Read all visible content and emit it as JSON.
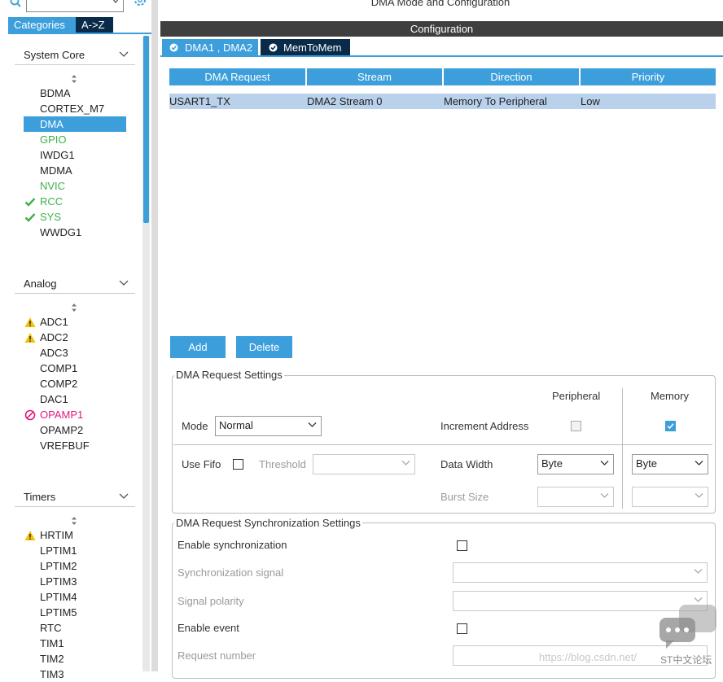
{
  "left_panel": {
    "search": {
      "value": ""
    },
    "tabs": [
      "Categories",
      "A->Z"
    ],
    "categories": [
      {
        "name": "System Core",
        "items": [
          {
            "label": "BDMA",
            "state": "none"
          },
          {
            "label": "CORTEX_M7",
            "state": "none"
          },
          {
            "label": "DMA",
            "state": "selected"
          },
          {
            "label": "GPIO",
            "state": "green"
          },
          {
            "label": "IWDG1",
            "state": "none"
          },
          {
            "label": "MDMA",
            "state": "none"
          },
          {
            "label": "NVIC",
            "state": "green"
          },
          {
            "label": "RCC",
            "state": "ok"
          },
          {
            "label": "SYS",
            "state": "ok"
          },
          {
            "label": "WWDG1",
            "state": "none"
          }
        ]
      },
      {
        "name": "Analog",
        "items": [
          {
            "label": "ADC1",
            "state": "warning"
          },
          {
            "label": "ADC2",
            "state": "warning"
          },
          {
            "label": "ADC3",
            "state": "none"
          },
          {
            "label": "COMP1",
            "state": "none"
          },
          {
            "label": "COMP2",
            "state": "none"
          },
          {
            "label": "DAC1",
            "state": "none"
          },
          {
            "label": "OPAMP1",
            "state": "error"
          },
          {
            "label": "OPAMP2",
            "state": "none"
          },
          {
            "label": "VREFBUF",
            "state": "none"
          }
        ]
      },
      {
        "name": "Timers",
        "items": [
          {
            "label": "HRTIM",
            "state": "warning"
          },
          {
            "label": "LPTIM1",
            "state": "none"
          },
          {
            "label": "LPTIM2",
            "state": "none"
          },
          {
            "label": "LPTIM3",
            "state": "none"
          },
          {
            "label": "LPTIM4",
            "state": "none"
          },
          {
            "label": "LPTIM5",
            "state": "none"
          },
          {
            "label": "RTC",
            "state": "none"
          },
          {
            "label": "TIM1",
            "state": "none"
          },
          {
            "label": "TIM2",
            "state": "none"
          },
          {
            "label": "TIM3",
            "state": "none"
          }
        ]
      }
    ]
  },
  "main": {
    "title": "DMA Mode and Configuration",
    "config_bar": "Configuration",
    "tabs": [
      "DMA1 , DMA2",
      "MemToMem"
    ],
    "table": {
      "headers": [
        "DMA Request",
        "Stream",
        "Direction",
        "Priority"
      ],
      "rows": [
        [
          "USART1_TX",
          "DMA2 Stream 0",
          "Memory To Peripheral",
          "Low"
        ]
      ]
    },
    "add_label": "Add",
    "delete_label": "Delete",
    "request_settings": {
      "legend": "DMA Request Settings",
      "peripheral_label": "Peripheral",
      "memory_label": "Memory",
      "mode_label": "Mode",
      "mode_value": "Normal",
      "increment_label": "Increment Address",
      "peripheral_increment": false,
      "memory_increment": true,
      "use_fifo_label": "Use Fifo",
      "threshold_label": "Threshold",
      "data_width_label": "Data Width",
      "peripheral_width": "Byte",
      "memory_width": "Byte",
      "burst_size_label": "Burst Size"
    },
    "sync_settings": {
      "legend": "DMA Request Synchronization Settings",
      "enable_sync_label": "Enable synchronization",
      "sync_signal_label": "Synchronization signal",
      "signal_polarity_label": "Signal polarity",
      "enable_event_label": "Enable event",
      "request_number_label": "Request number"
    },
    "watermark": "https://blog.csdn.net/",
    "watermark_logo_text": "ST中文论坛"
  },
  "colors": {
    "accent": "#3c9fdc",
    "dark_tab": "#0a2a4a",
    "selected_row": "#b9d1ea",
    "ok_green": "#3db14a",
    "error_pink": "#e0197d",
    "warning_yellow": "#f2c200"
  }
}
